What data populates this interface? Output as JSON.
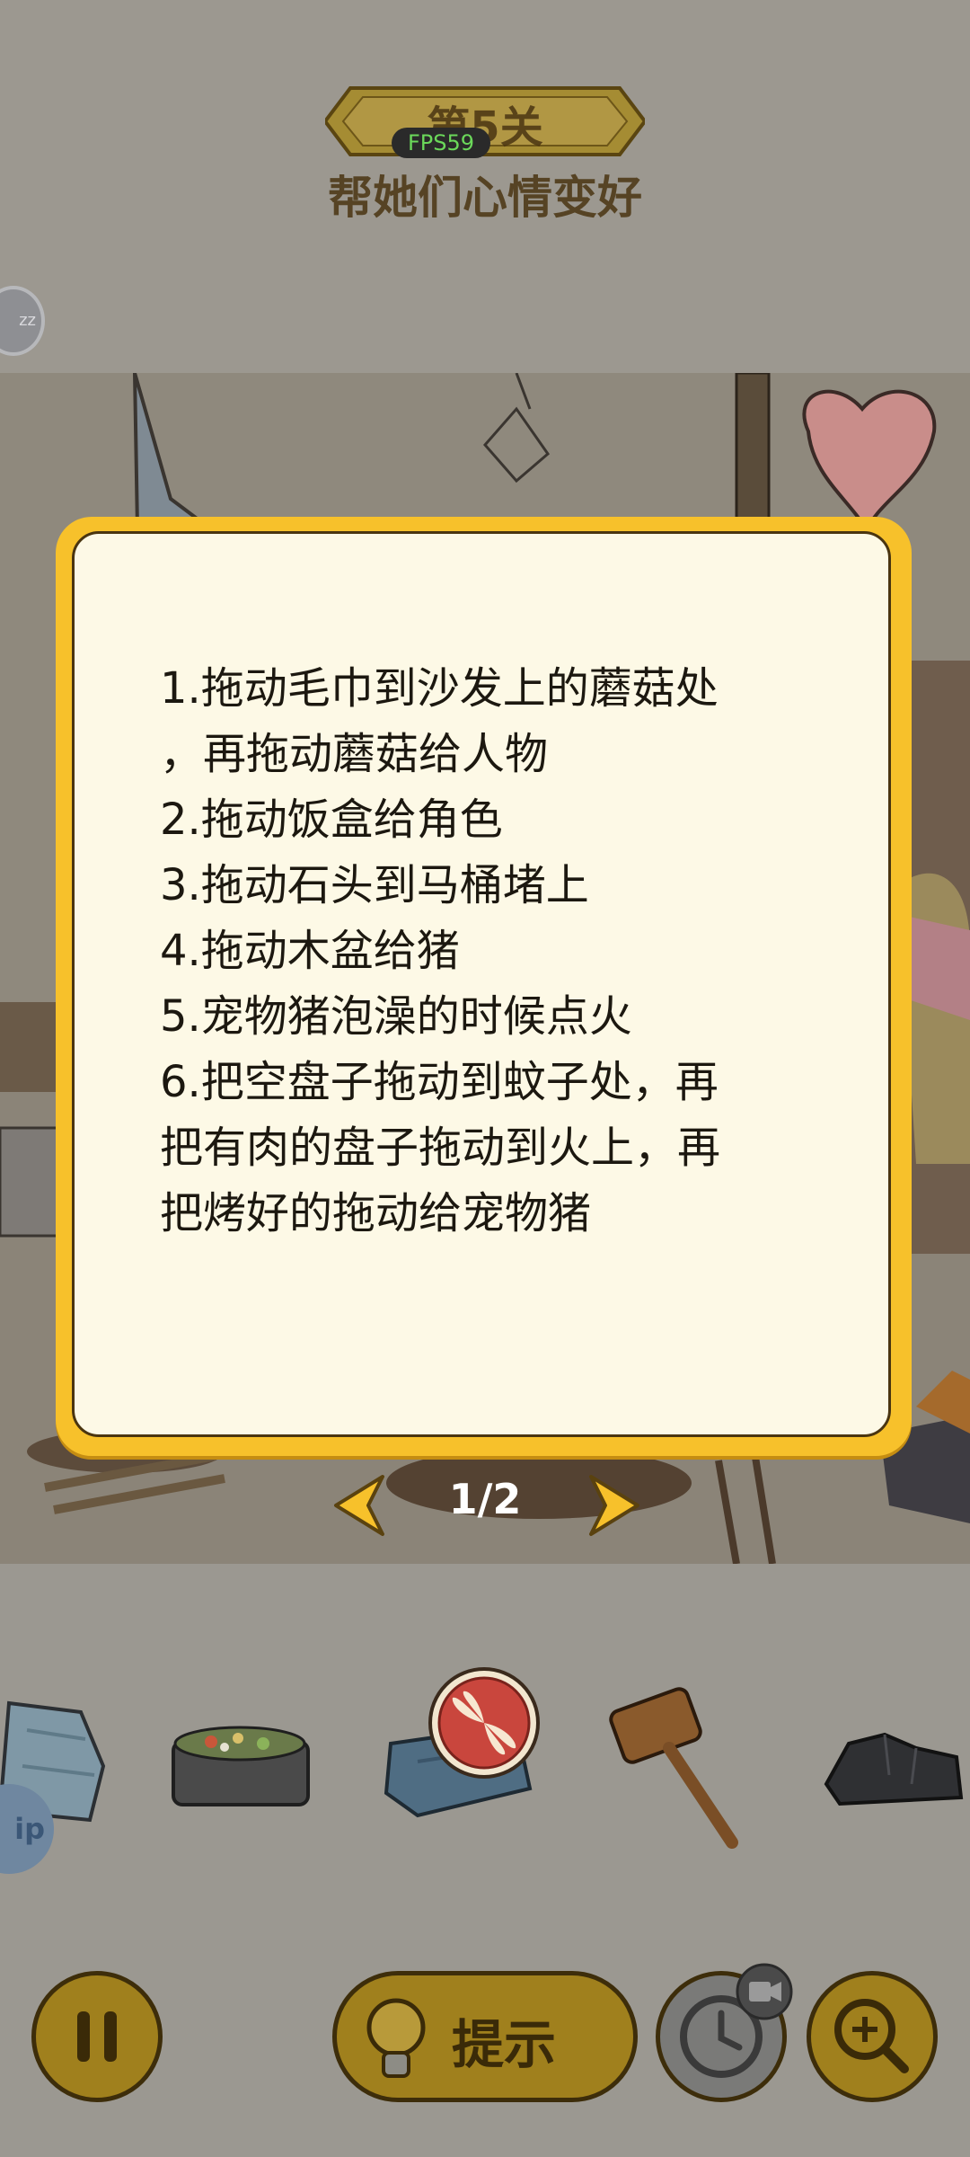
{
  "header": {
    "level_label": "第5关",
    "fps_label": "FPS59",
    "task_title": "帮她们心情变好"
  },
  "side_bubble_text": "zz",
  "help_tab_text": "ip",
  "dialog": {
    "lines": [
      "1.拖动毛巾到沙发上的蘑菇处",
      "，再拖动蘑菇给人物",
      "2.拖动饭盒给角色",
      "3.拖动石头到马桶堵上",
      "4.拖动木盆给猪",
      "5.宠物猪泡澡的时候点火",
      "6.把空盘子拖动到蚊子处，再",
      "把有肉的盘子拖动到火上，再",
      "把烤好的拖动给宠物猪"
    ],
    "page_indicator": "1/2"
  },
  "inventory": {
    "items": [
      "towel",
      "food-box",
      "jeans",
      "wooden-mallet",
      "coal-rock"
    ]
  },
  "bottom_bar": {
    "hint_label": "提示"
  },
  "colors": {
    "dialog_border": "#f7c12b",
    "dialog_fill": "#fdf9e6",
    "button_gold": "#a0801d",
    "close_red": "#c9463d"
  }
}
